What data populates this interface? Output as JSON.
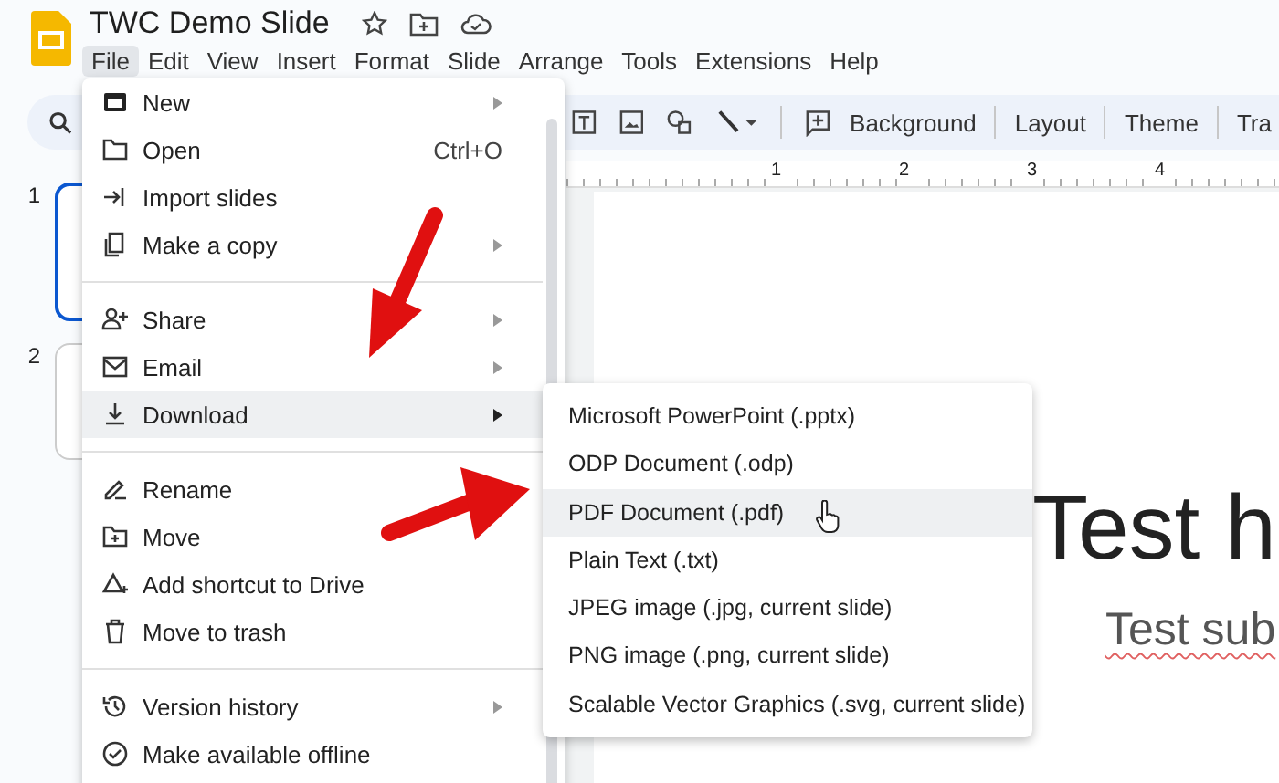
{
  "document": {
    "title": "TWC Demo Slide"
  },
  "menubar": [
    {
      "label": "File",
      "selected": true
    },
    {
      "label": "Edit",
      "selected": false
    },
    {
      "label": "View",
      "selected": false
    },
    {
      "label": "Insert",
      "selected": false
    },
    {
      "label": "Format",
      "selected": false
    },
    {
      "label": "Slide",
      "selected": false
    },
    {
      "label": "Arrange",
      "selected": false
    },
    {
      "label": "Tools",
      "selected": false
    },
    {
      "label": "Extensions",
      "selected": false
    },
    {
      "label": "Help",
      "selected": false
    }
  ],
  "toolbar": {
    "buttons": [
      "Background",
      "Layout",
      "Theme",
      "Tra"
    ]
  },
  "ruler": {
    "labels": [
      "1",
      "2",
      "3",
      "4"
    ]
  },
  "filmstrip": [
    {
      "number": "1",
      "selected": true
    },
    {
      "number": "2",
      "selected": false
    }
  ],
  "slide": {
    "title": "Test h",
    "subtitle": "Test sub"
  },
  "file_menu": [
    {
      "kind": "item",
      "label": "New",
      "submenu": true,
      "selected": false
    },
    {
      "kind": "item",
      "label": "Open",
      "shortcut": "Ctrl+O",
      "submenu": false,
      "selected": false
    },
    {
      "kind": "item",
      "label": "Import slides",
      "submenu": false,
      "selected": false
    },
    {
      "kind": "item",
      "label": "Make a copy",
      "submenu": true,
      "selected": false
    },
    {
      "kind": "divider"
    },
    {
      "kind": "item",
      "label": "Share",
      "submenu": true,
      "selected": false
    },
    {
      "kind": "item",
      "label": "Email",
      "submenu": true,
      "selected": false
    },
    {
      "kind": "item",
      "label": "Download",
      "submenu": true,
      "selected": true
    },
    {
      "kind": "divider"
    },
    {
      "kind": "item",
      "label": "Rename",
      "submenu": false,
      "selected": false
    },
    {
      "kind": "item",
      "label": "Move",
      "submenu": false,
      "selected": false
    },
    {
      "kind": "item",
      "label": "Add shortcut to Drive",
      "submenu": false,
      "selected": false
    },
    {
      "kind": "item",
      "label": "Move to trash",
      "submenu": false,
      "selected": false
    },
    {
      "kind": "divider"
    },
    {
      "kind": "item",
      "label": "Version history",
      "submenu": true,
      "selected": false
    },
    {
      "kind": "item",
      "label": "Make available offline",
      "submenu": false,
      "selected": false
    }
  ],
  "download_menu": [
    {
      "label": "Microsoft PowerPoint (.pptx)",
      "selected": false
    },
    {
      "label": "ODP Document (.odp)",
      "selected": false
    },
    {
      "label": "PDF Document (.pdf)",
      "selected": true
    },
    {
      "label": "Plain Text (.txt)",
      "selected": false
    },
    {
      "label": "JPEG image (.jpg, current slide)",
      "selected": false
    },
    {
      "label": "PNG image (.png, current slide)",
      "selected": false
    },
    {
      "label": "Scalable Vector Graphics (.svg, current slide)",
      "selected": false
    }
  ]
}
